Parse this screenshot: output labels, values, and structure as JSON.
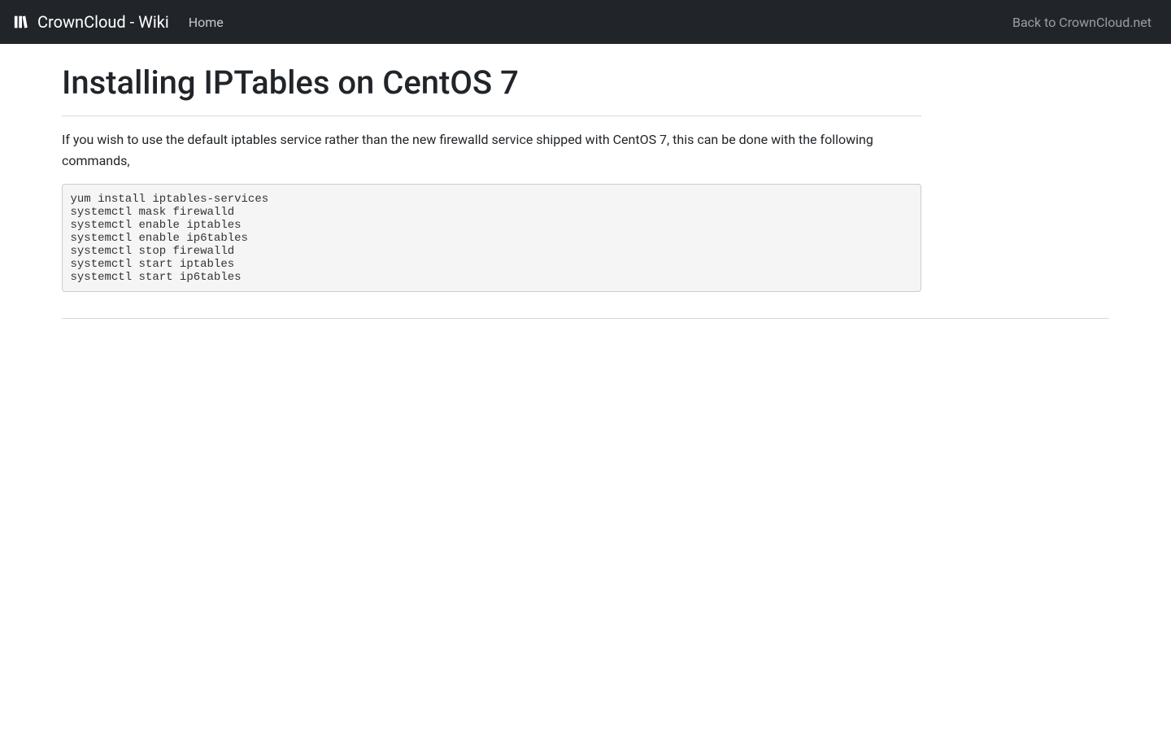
{
  "navbar": {
    "brand": "CrownCloud - Wiki",
    "home_link": "Home",
    "back_link": "Back to CrownCloud.net"
  },
  "article": {
    "title": "Installing IPTables on CentOS 7",
    "intro": "If you wish to use the default iptables service rather than the new firewalld service shipped with CentOS 7, this can be done with the following commands,",
    "code": "yum install iptables-services\nsystemctl mask firewalld\nsystemctl enable iptables\nsystemctl enable ip6tables\nsystemctl stop firewalld\nsystemctl start iptables\nsystemctl start ip6tables"
  }
}
